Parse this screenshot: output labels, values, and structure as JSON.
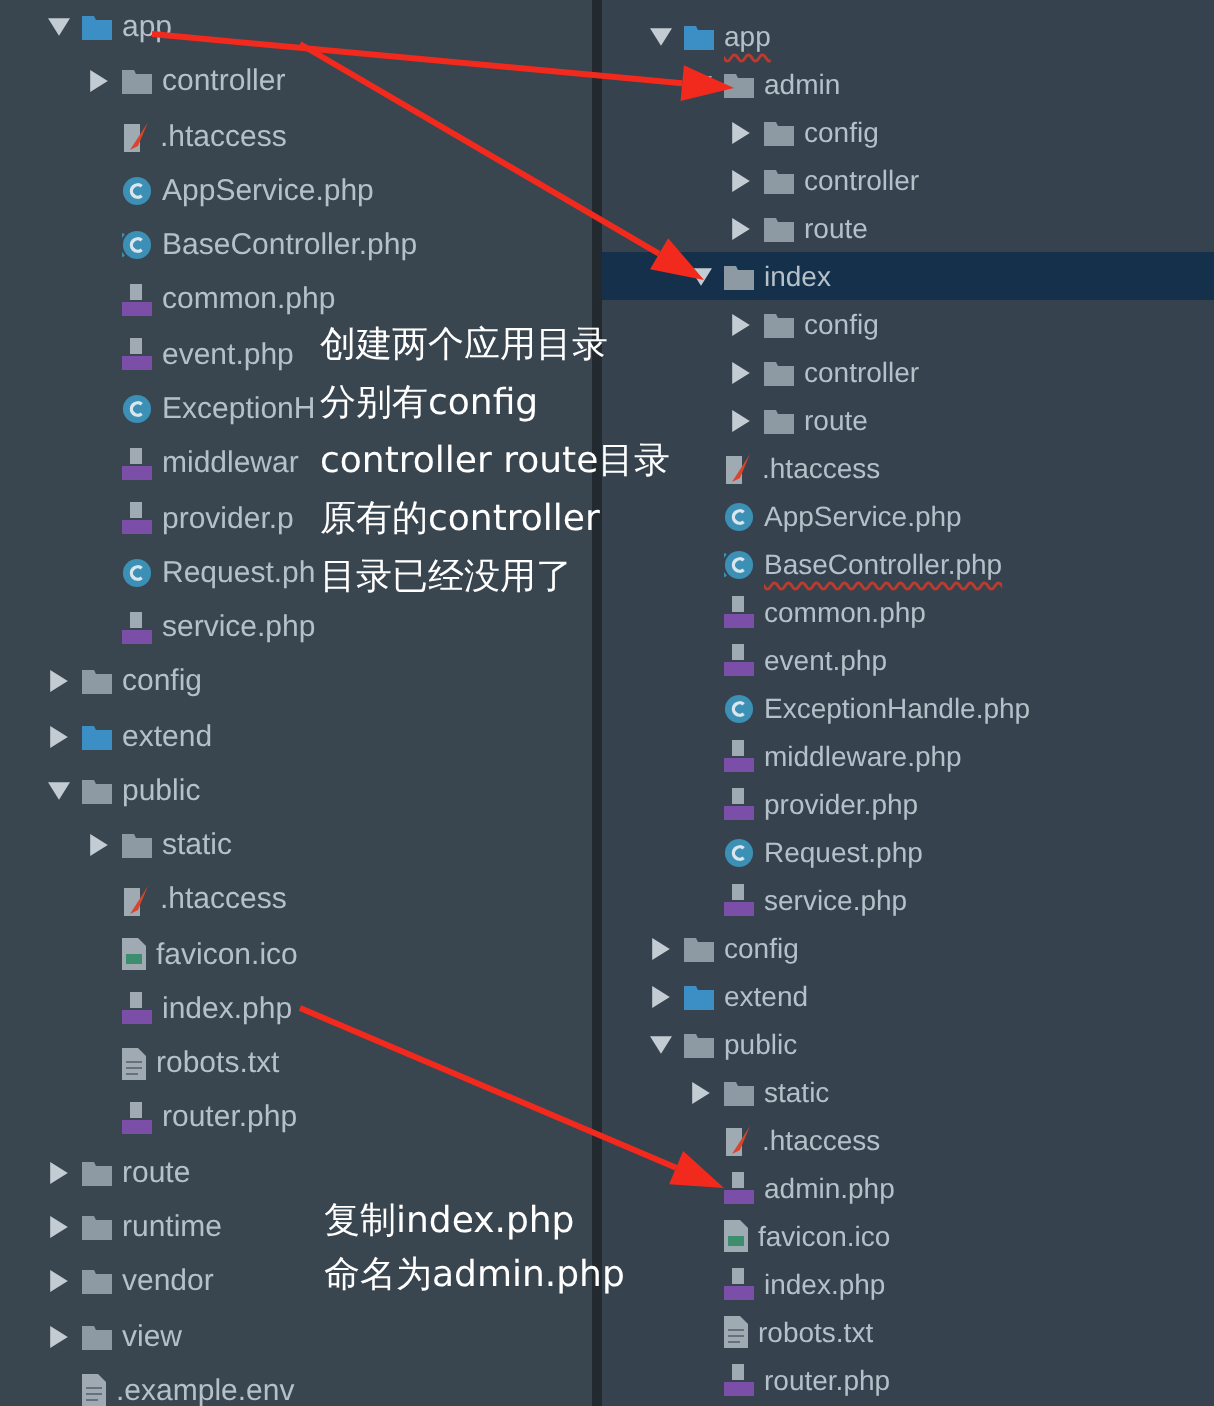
{
  "left_tree": [
    {
      "name": "app",
      "kind": "source-folder",
      "expanded": true,
      "children": [
        {
          "name": "controller",
          "kind": "folder",
          "expanded": false
        },
        {
          "name": ".htaccess",
          "kind": "htaccess"
        },
        {
          "name": "AppService.php",
          "kind": "class"
        },
        {
          "name": "BaseController.php",
          "kind": "abstract-class"
        },
        {
          "name": "common.php",
          "kind": "php"
        },
        {
          "name": "event.php",
          "kind": "php"
        },
        {
          "name": "ExceptionH",
          "kind": "class"
        },
        {
          "name": "middlewar",
          "kind": "php"
        },
        {
          "name": "provider.p",
          "kind": "php"
        },
        {
          "name": "Request.ph",
          "kind": "class"
        },
        {
          "name": "service.php",
          "kind": "php"
        }
      ]
    },
    {
      "name": "config",
      "kind": "folder",
      "expanded": false
    },
    {
      "name": "extend",
      "kind": "source-folder",
      "expanded": false
    },
    {
      "name": "public",
      "kind": "folder",
      "expanded": true,
      "children": [
        {
          "name": "static",
          "kind": "folder",
          "expanded": false
        },
        {
          "name": ".htaccess",
          "kind": "htaccess"
        },
        {
          "name": "favicon.ico",
          "kind": "image"
        },
        {
          "name": "index.php",
          "kind": "php"
        },
        {
          "name": "robots.txt",
          "kind": "text"
        },
        {
          "name": "router.php",
          "kind": "php"
        }
      ]
    },
    {
      "name": "route",
      "kind": "folder",
      "expanded": false
    },
    {
      "name": "runtime",
      "kind": "folder",
      "expanded": false
    },
    {
      "name": "vendor",
      "kind": "folder",
      "expanded": false
    },
    {
      "name": "view",
      "kind": "folder",
      "expanded": false
    },
    {
      "name": ".example.env",
      "kind": "text"
    }
  ],
  "right_tree": [
    {
      "name": "app",
      "kind": "source-folder",
      "expanded": true,
      "selected": false,
      "error": true,
      "children": [
        {
          "name": "admin",
          "kind": "folder",
          "expanded": true,
          "selected": false,
          "children": [
            {
              "name": "config",
              "kind": "folder",
              "expanded": false,
              "selected": false
            },
            {
              "name": "controller",
              "kind": "folder",
              "expanded": false,
              "selected": false
            },
            {
              "name": "route",
              "kind": "folder",
              "expanded": false,
              "selected": false
            }
          ]
        },
        {
          "name": "index",
          "kind": "folder",
          "expanded": true,
          "selected": true,
          "children": [
            {
              "name": "config",
              "kind": "folder",
              "expanded": false,
              "selected": false
            },
            {
              "name": "controller",
              "kind": "folder",
              "expanded": false,
              "selected": false
            },
            {
              "name": "route",
              "kind": "folder",
              "expanded": false,
              "selected": false
            }
          ]
        },
        {
          "name": ".htaccess",
          "kind": "htaccess",
          "selected": false
        },
        {
          "name": "AppService.php",
          "kind": "class",
          "selected": false
        },
        {
          "name": "BaseController.php",
          "kind": "abstract-class",
          "selected": false,
          "error": true
        },
        {
          "name": "common.php",
          "kind": "php",
          "selected": false
        },
        {
          "name": "event.php",
          "kind": "php",
          "selected": false
        },
        {
          "name": "ExceptionHandle.php",
          "kind": "class",
          "selected": false
        },
        {
          "name": "middleware.php",
          "kind": "php",
          "selected": false
        },
        {
          "name": "provider.php",
          "kind": "php",
          "selected": false
        },
        {
          "name": "Request.php",
          "kind": "class",
          "selected": false
        },
        {
          "name": "service.php",
          "kind": "php",
          "selected": false
        }
      ]
    },
    {
      "name": "config",
      "kind": "folder",
      "expanded": false,
      "selected": false
    },
    {
      "name": "extend",
      "kind": "source-folder",
      "expanded": false,
      "selected": false
    },
    {
      "name": "public",
      "kind": "folder",
      "expanded": true,
      "selected": false,
      "children": [
        {
          "name": "static",
          "kind": "folder",
          "expanded": false,
          "selected": false
        },
        {
          "name": ".htaccess",
          "kind": "htaccess",
          "selected": false
        },
        {
          "name": "admin.php",
          "kind": "php",
          "selected": false
        },
        {
          "name": "favicon.ico",
          "kind": "image",
          "selected": false
        },
        {
          "name": "index.php",
          "kind": "php",
          "selected": false
        },
        {
          "name": "robots.txt",
          "kind": "text",
          "selected": false
        },
        {
          "name": "router.php",
          "kind": "php",
          "selected": false
        }
      ]
    }
  ],
  "annotations": [
    {
      "lines": [
        "创建两个应用目录",
        "分别有config",
        "controller route目录",
        "原有的controller",
        "目录已经没用了"
      ]
    },
    {
      "lines": [
        "复制index.php",
        "命名为admin.php"
      ]
    }
  ]
}
